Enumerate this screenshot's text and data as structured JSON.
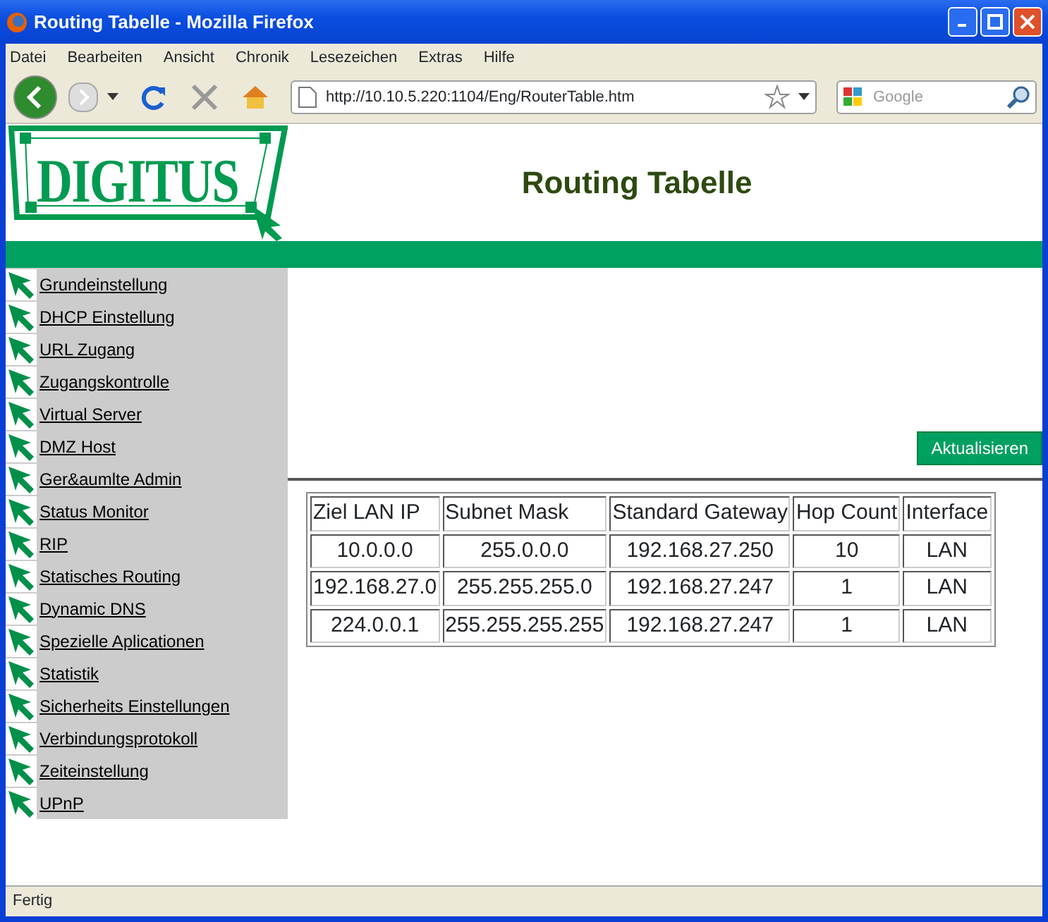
{
  "window": {
    "title": "Routing Tabelle - Mozilla Firefox"
  },
  "menu": [
    "Datei",
    "Bearbeiten",
    "Ansicht",
    "Chronik",
    "Lesezeichen",
    "Extras",
    "Hilfe"
  ],
  "toolbar": {
    "url": "http://10.10.5.220:1104/Eng/RouterTable.htm",
    "search": {
      "placeholder": "Google"
    }
  },
  "logo": {
    "text": "DIGITUS"
  },
  "page": {
    "heading": "Routing Tabelle"
  },
  "sidebar": {
    "items": [
      "Grundeinstellung",
      "DHCP Einstellung",
      "URL Zugang",
      "Zugangskontrolle",
      "Virtual Server",
      "DMZ Host",
      "Ger&aumlte Admin",
      "Status Monitor",
      "RIP",
      "Statisches Routing",
      "Dynamic DNS",
      "Spezielle Aplicationen",
      "Statistik",
      "Sicherheits Einstellungen",
      "Verbindungsprotokoll",
      "Zeiteinstellung",
      "UPnP"
    ]
  },
  "refresh_button": "Aktualisieren",
  "table": {
    "columns": [
      "Ziel LAN IP",
      "Subnet Mask",
      "Standard Gateway",
      "Hop Count",
      "Interface"
    ],
    "rows": [
      [
        "10.0.0.0",
        "255.0.0.0",
        "192.168.27.250",
        "10",
        "LAN"
      ],
      [
        "192.168.27.0",
        "255.255.255.0",
        "192.168.27.247",
        "1",
        "LAN"
      ],
      [
        "224.0.0.1",
        "255.255.255.255",
        "192.168.27.247",
        "1",
        "LAN"
      ]
    ]
  },
  "status_bar": "Fertig"
}
